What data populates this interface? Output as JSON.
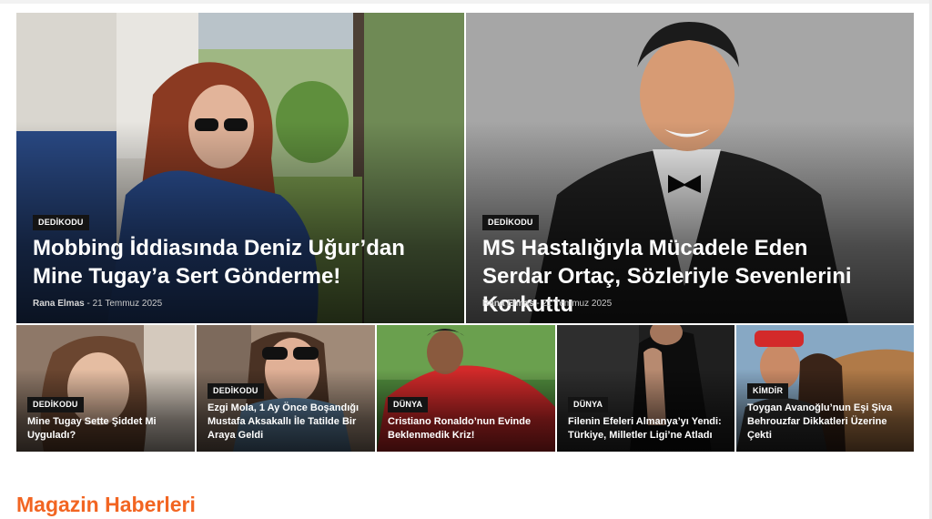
{
  "featured": [
    {
      "category": "DEDİKODU",
      "title": "Mobbing İddiasında Deniz Uğur’dan Mine Tugay’a Sert Gönderme!",
      "author": "Rana Elmas",
      "date": "21 Temmuz 2025"
    },
    {
      "category": "DEDİKODU",
      "title": "MS Hastalığıyla Mücadele Eden Serdar Ortaç, Sözleriyle Sevenlerini Korkuttu",
      "author": "Rana Elmas",
      "date": "21 Temmuz 2025"
    }
  ],
  "grid": [
    {
      "category": "DEDİKODU",
      "title": "Mine Tugay Sette Şiddet Mi Uyguladı?"
    },
    {
      "category": "DEDİKODU",
      "title": "Ezgi Mola, 1 Ay Önce Boşandığı Mustafa Aksakallı İle Tatilde Bir Araya Geldi"
    },
    {
      "category": "DÜNYA",
      "title": "Cristiano Ronaldo’nun Evinde Beklenmedik Kriz!"
    },
    {
      "category": "DÜNYA",
      "title": "Filenin Efeleri Almanya’yı Yendi: Türkiye, Milletler Ligi’ne Atladı"
    },
    {
      "category": "KİMDİR",
      "title": "Toygan Avanoğlu’nun Eşi Şiva Behrouzfar Dikkatleri Üzerine Çekti"
    }
  ],
  "section": {
    "title": "Magazin Haberleri"
  },
  "meta_separator": "-"
}
